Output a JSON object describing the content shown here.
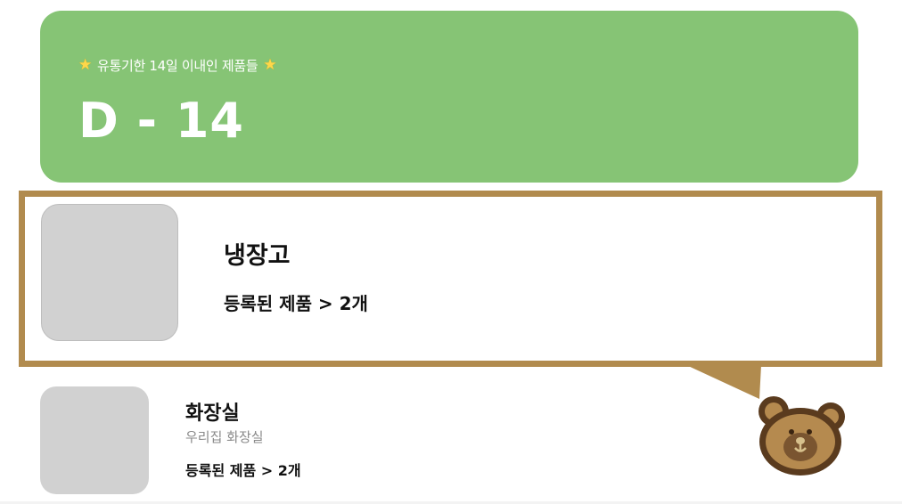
{
  "banner": {
    "subtitle_prefix_icon": "star-icon",
    "subtitle": "유통기한 14일 이내인 제품들",
    "title": "D - 14",
    "color": "#86c475"
  },
  "selected_card": {
    "title": "냉장고",
    "count_text": "등록된 제품 > 2개",
    "border_color": "#b18b4e"
  },
  "list_item": {
    "title": "화장실",
    "subtitle": "우리집 화장실",
    "count_text": "등록된 제품 > 2개"
  },
  "mascot": {
    "icon": "bear-icon"
  }
}
